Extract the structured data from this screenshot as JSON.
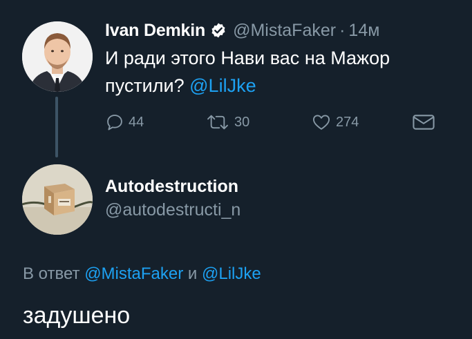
{
  "colors": {
    "background": "#15202b",
    "accent": "#1da1f2",
    "muted": "#8899a6",
    "text": "#ffffff"
  },
  "parent_tweet": {
    "display_name": "Ivan Demkin",
    "verified_icon": "verified-badge-icon",
    "handle": "@MistaFaker",
    "separator": "·",
    "time": "14м",
    "text": "И ради этого Нави вас на Мажор пустили?",
    "mention": "@LilJke",
    "actions": {
      "reply_icon": "reply-icon",
      "reply_count": "44",
      "retweet_icon": "retweet-icon",
      "retweet_count": "30",
      "like_icon": "heart-icon",
      "like_count": "274",
      "dm_icon": "envelope-icon"
    }
  },
  "reply_tweet": {
    "display_name": "Autodestruction",
    "handle": "@autodestructi_n",
    "reply_to_prefix": "В ответ",
    "reply_to_mention_1": "@MistaFaker",
    "reply_to_conjunction": "и",
    "reply_to_mention_2": "@LilJke",
    "text": "задушено"
  }
}
